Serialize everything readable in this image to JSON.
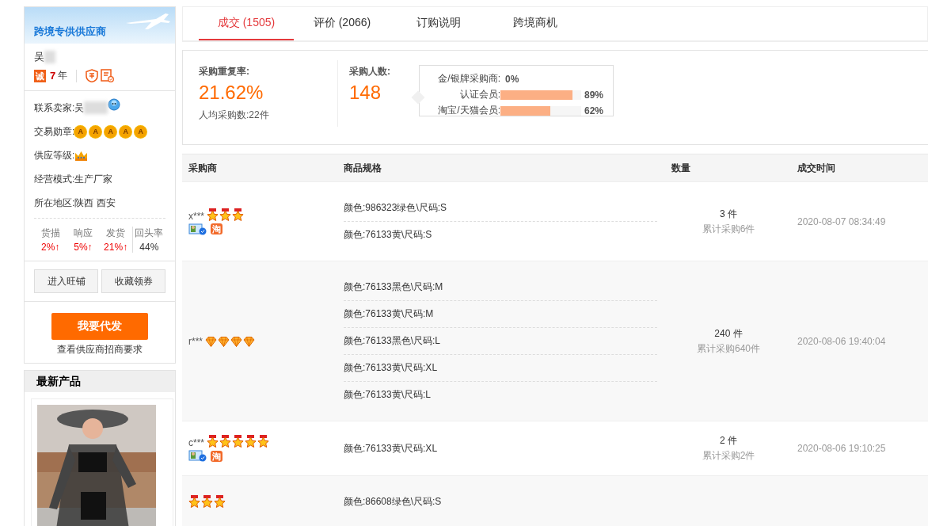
{
  "supplier": {
    "banner_title": "跨境专供供应商",
    "name": "吴",
    "years": "7",
    "years_unit": "年",
    "cheng_badge": "诚"
  },
  "seller_info": [
    {
      "kind": "contact",
      "label": "联系卖家:",
      "value": "吴"
    },
    {
      "kind": "medals",
      "label": "交易勋章:",
      "medals": [
        "A",
        "A",
        "A",
        "A",
        "A"
      ]
    },
    {
      "kind": "crown",
      "label": "供应等级:"
    },
    {
      "kind": "text",
      "label": "经营模式:",
      "value": "生产厂家"
    },
    {
      "kind": "text",
      "label": "所在地区:",
      "value": "陕西 西安"
    }
  ],
  "ratings": [
    {
      "label": "货描",
      "value": "2%↑",
      "highlight": true
    },
    {
      "label": "响应",
      "value": "5%↑",
      "highlight": true
    },
    {
      "label": "发货",
      "value": "21%↑",
      "highlight": true
    },
    {
      "label": "回头率",
      "value": "44%",
      "highlight": false
    }
  ],
  "shop_buttons": [
    "进入旺铺",
    "收藏领券"
  ],
  "dropship_button": "我要代发",
  "dropship_link": "查看供应商招商要求",
  "latest_products": {
    "title": "最新产品"
  },
  "tabs": [
    {
      "label": "成交 (1505)",
      "selected": true
    },
    {
      "label": "评价 (2066)",
      "selected": false
    },
    {
      "label": "订购说明",
      "selected": false
    },
    {
      "label": "跨境商机",
      "selected": false
    }
  ],
  "stats": {
    "repeat_label": "采购重复率:",
    "repeat_value": "21.62%",
    "avg_label": "人均采购数:",
    "avg_value": "22件",
    "buyers_label": "采购人数:",
    "buyers_value": "148",
    "buyer_types": [
      {
        "label": "金/银牌采购商:",
        "reading": "0%"
      },
      {
        "label": "认证会员:",
        "reading": "89%",
        "level": 0.89
      },
      {
        "label": "淘宝/天猫会员:",
        "reading": "62%",
        "level": 0.62
      }
    ]
  },
  "table": {
    "columns": [
      "采购商",
      "商品规格",
      "数量",
      "成交时间"
    ],
    "rows": [
      {
        "buyer": "x***",
        "kind": "star",
        "stars": 3,
        "verified": true,
        "tag": "淘",
        "specs": [
          "颜色:986323绿色\\尺码:S",
          "颜色:76133黄\\尺码:S"
        ],
        "quantity": "3 件",
        "total": "累计采购6件",
        "time": "2020-08-07 08:34:49"
      },
      {
        "buyer": "r***",
        "kind": "diamond",
        "stars": 4,
        "verified": false,
        "specs": [
          "颜色:76133黑色\\尺码:M",
          "颜色:76133黄\\尺码:M",
          "颜色:76133黑色\\尺码:L",
          "颜色:76133黄\\尺码:XL",
          "颜色:76133黄\\尺码:L"
        ],
        "quantity": "240 件",
        "total": "累计采购640件",
        "time": "2020-08-06 19:40:04"
      },
      {
        "buyer": "c***",
        "kind": "star",
        "stars": 5,
        "verified": true,
        "tag": "淘",
        "specs": [
          "颜色:76133黄\\尺码:XL"
        ],
        "quantity": "2 件",
        "total": "累计采购2件",
        "time": "2020-08-06 19:10:25"
      },
      {
        "kind": "star",
        "stars": 3,
        "verified": false,
        "specs": [
          "颜色:86608绿色\\尺码:S"
        ]
      }
    ]
  }
}
